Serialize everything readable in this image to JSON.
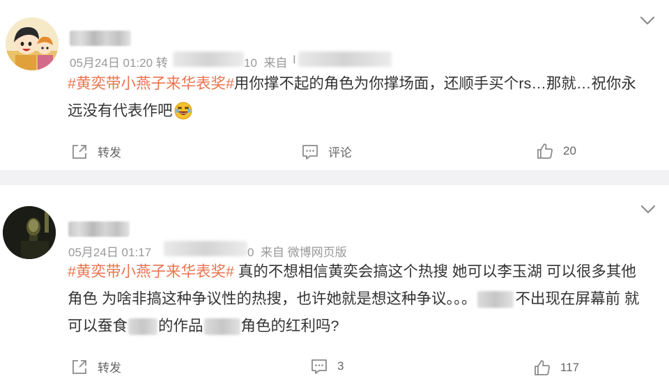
{
  "posts": [
    {
      "meta_date": "05月24日 01:20 转",
      "meta_tail": "10  来自 ",
      "meta_source": "",
      "topic": "#黄奕带小燕子来华表奖#",
      "line1": "用你撑不起的角色为你撑场面，还顺手买个rs…那就…祝你永",
      "line2": "远没有代表作吧",
      "emoji": "laughing-face-icon",
      "actions": {
        "repost": "转发",
        "comment": "评论",
        "like": "20"
      }
    },
    {
      "meta_date": "05月24日 01:17 ",
      "meta_tail": "0  来自 微博网页版",
      "topic": "#黄奕带小燕子来华表奖#",
      "line1": " 真的不想相信黄奕会搞这个热搜 她可以李玉湖 可以很多其他",
      "line2a": "角色 为啥非搞这种争议性的热搜，也许她就是想这种争议。。。",
      "line2b": "不出现在屏幕前 就",
      "line3a": "可以蚕食",
      "line3b": "的作品",
      "line3c": "角色的红利吗?",
      "actions": {
        "repost": "转发",
        "comment": "3",
        "like": "117"
      }
    }
  ],
  "colors": {
    "topic": "#eb7350",
    "text": "#333333",
    "meta": "#999999",
    "separator": "#f2f2f5"
  }
}
